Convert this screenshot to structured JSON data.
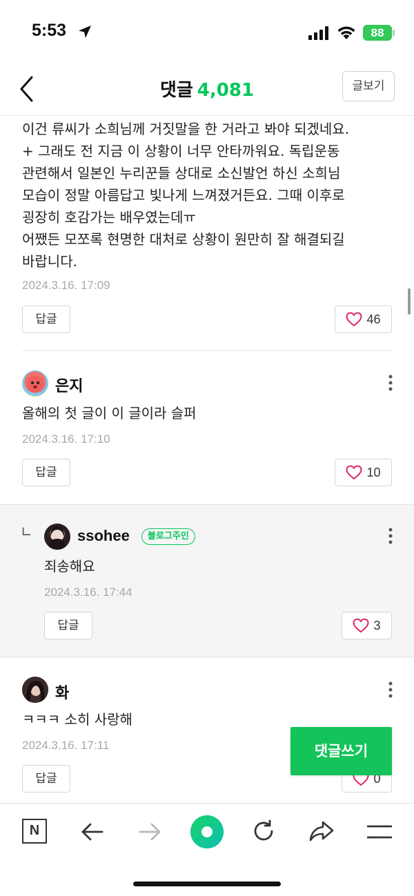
{
  "status_bar": {
    "time": "5:53",
    "battery": "88"
  },
  "header": {
    "title": "댓글",
    "count": "4,081",
    "view_post_label": "글보기"
  },
  "comments": [
    {
      "lines": [
        "이건 류씨가 소희님께 거짓말을 한 거라고 봐야 되겠네요.",
        "+ 그래도 전 지금 이 상황이 너무 안타까워요. 독립운동",
        "관련해서 일본인 누리꾼들 상대로 소신발언 하신 소희님",
        "모습이 정말 아름답고 빛나게 느껴졌거든요. 그때 이후로",
        "굉장히 호감가는 배우였는데ㅠ",
        "어쨌든 모쪼록 현명한 대처로 상황이 원만히 잘 해결되길",
        "바랍니다."
      ],
      "date": "2024.3.16. 17:09",
      "reply_label": "답글",
      "likes": "46"
    },
    {
      "author": "은지",
      "text": "올해의 첫 글이 이 글이라 슬퍼",
      "date": "2024.3.16. 17:10",
      "reply_label": "답글",
      "likes": "10"
    },
    {
      "author": "ssohee",
      "badge": "블로그주인",
      "text": "죄송해요",
      "date": "2024.3.16. 17:44",
      "reply_label": "답글",
      "likes": "3"
    },
    {
      "author": "화",
      "text": "ㅋㅋㅋ 소히 사랑해",
      "date": "2024.3.16. 17:11",
      "reply_label": "답글",
      "likes": "0"
    }
  ],
  "write_button": "댓글쓰기",
  "reply_marker": "∟",
  "colors": {
    "accent": "#03c75a",
    "like": "#e0245e",
    "reply_bg": "#f5f5f5"
  },
  "toolbar": {
    "icons": [
      "naver-n-icon",
      "back-arrow-icon",
      "forward-arrow-icon",
      "home-circle-icon",
      "refresh-icon",
      "share-icon",
      "menu-icon"
    ],
    "n_label": "N"
  }
}
